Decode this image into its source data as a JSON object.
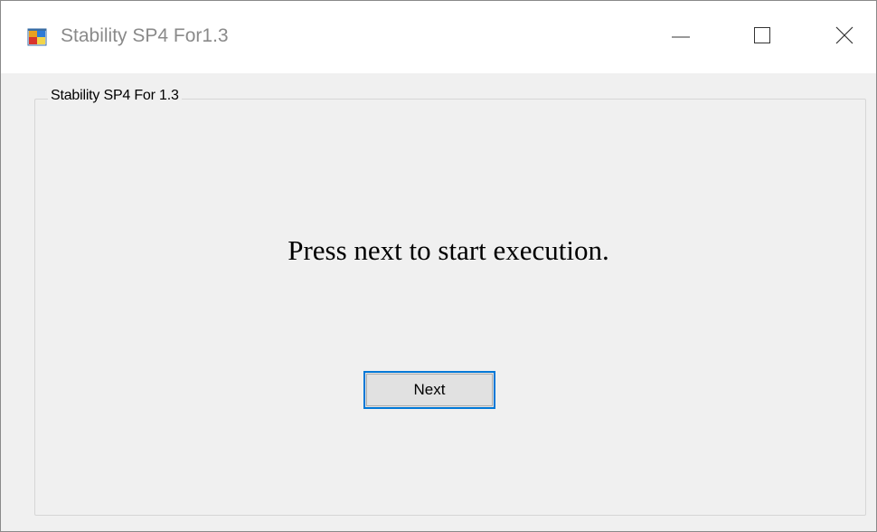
{
  "window": {
    "title": "Stability SP4 For1.3",
    "icon": "app-window-icon",
    "controls": {
      "minimize_icon": "minimize-icon",
      "maximize_icon": "maximize-icon",
      "close_icon": "close-icon"
    }
  },
  "group": {
    "legend": "Stability SP4 For 1.3"
  },
  "main": {
    "message": "Press next to start execution.",
    "next_label": "Next"
  },
  "colors": {
    "accent": "#0078d7",
    "button_face": "#e1e1e1",
    "window_bg": "#f0f0f0",
    "title_text": "#8a8a8a"
  }
}
